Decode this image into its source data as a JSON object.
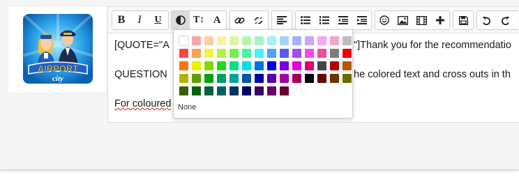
{
  "avatar": {
    "alt": "Airport City app icon",
    "logo_text_top": "AIRPORT",
    "logo_text_bottom": "city"
  },
  "toolbar": {
    "bold": "B",
    "italic": "I",
    "underline": "U",
    "font_size": "T↕",
    "font_family": "A",
    "icons": {
      "text_color": "contrast-icon",
      "link": "link-icon",
      "unlink": "unlink-icon",
      "align": "align-left-icon",
      "bullet_list": "bullet-list-icon",
      "numbered_list": "numbered-list-icon",
      "outdent": "outdent-icon",
      "indent": "indent-icon",
      "smilies": "smiley-icon",
      "image": "image-icon",
      "media": "film-icon",
      "insert": "plus-icon",
      "save": "save-icon",
      "undo": "undo-icon",
      "redo": "redo-icon"
    }
  },
  "editor": {
    "line1_start": "[QUOTE=\"A",
    "line1_end": "\"]Thank you for the recommendatio",
    "line2_start": "QUESTION",
    "line2_end": "he colored text and cross outs in th",
    "line3_start": "For coloured"
  },
  "palette": {
    "none_label": "None",
    "rows": [
      [
        "#ffffff",
        "#f7a6a6",
        "#fbd1a3",
        "#fbf2a1",
        "#d8f7a1",
        "#b6f4a6",
        "#a4f3c9",
        "#a4f2ef",
        "#a7d2f7",
        "#a8b1f8",
        "#c8a7f7",
        "#f5a8f5",
        "#f4a6ca"
      ],
      [
        "#bdbdbd",
        "#f24a4a",
        "#f6a551",
        "#f3f34c",
        "#b4f24a",
        "#6ff24d",
        "#4cf2a0",
        "#4cf2f2",
        "#4ca5f2",
        "#5a5af2",
        "#a34cf2",
        "#f24cf2",
        "#f24ca3"
      ],
      [
        "#7d7d7d",
        "#ee0000",
        "#f27700",
        "#eeee00",
        "#86d900",
        "#18dd18",
        "#00e08a",
        "#00e0e0",
        "#0072e0",
        "#0000e6",
        "#7a00e0",
        "#e000e0",
        "#e0006f"
      ],
      [
        "#444444",
        "#b30000",
        "#b45700",
        "#b4b400",
        "#5f9e00",
        "#0aa20a",
        "#00a066",
        "#00a3a3",
        "#0056a8",
        "#0000a8",
        "#5a00a8",
        "#a800a8",
        "#a80055"
      ],
      [
        "#000000",
        "#6a0000",
        "#6b3400",
        "#6b6b00",
        "#385e00",
        "#086008",
        "#005f3e",
        "#006161",
        "#003366",
        "#000066",
        "#380066",
        "#660066",
        "#660033"
      ]
    ]
  }
}
